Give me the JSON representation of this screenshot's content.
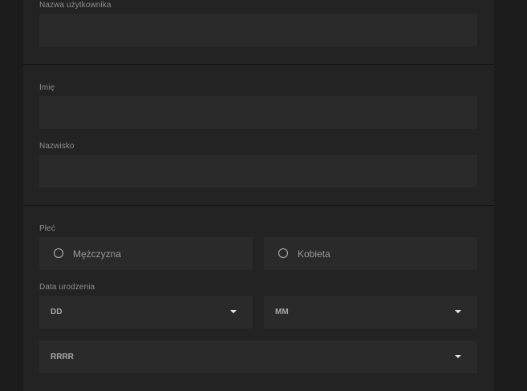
{
  "account": {
    "username_label": "Nazwa użytkownika",
    "username_value": ""
  },
  "personal": {
    "first_name_label": "Imię",
    "first_name_value": "",
    "last_name_label": "Nazwisko",
    "last_name_value": ""
  },
  "details": {
    "gender_label": "Płeć",
    "gender_options": [
      "Mężczyzna",
      "Kobieta"
    ],
    "birthdate_label": "Data urodzenia",
    "day_placeholder": "DD",
    "month_placeholder": "MM",
    "year_placeholder": "RRRR"
  },
  "colors": {
    "page_background": "#1c1c1c",
    "panel_background": "#232323",
    "field_background": "#2a2a2a",
    "label_text": "#8e8e8e"
  }
}
